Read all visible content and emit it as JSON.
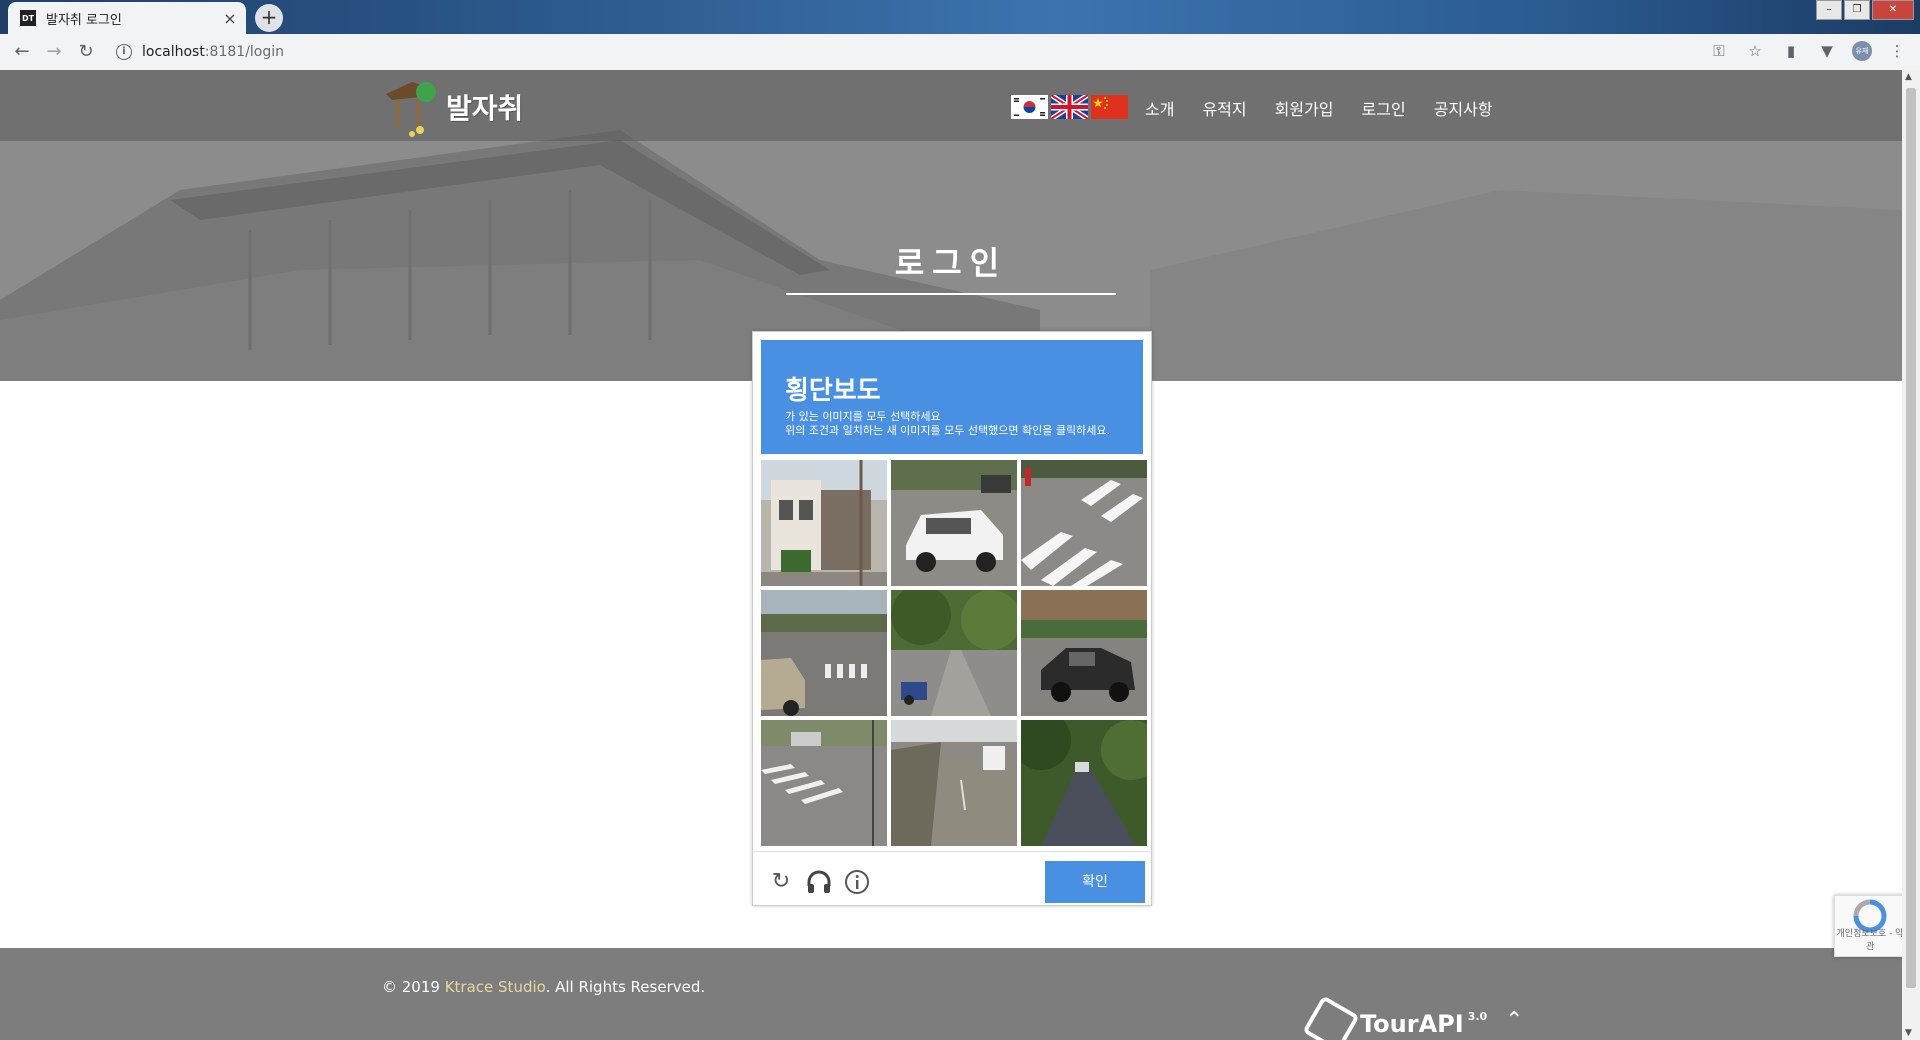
{
  "browser": {
    "tab_title": "발자취 로그인",
    "favicon": "DT",
    "tab_close": "×",
    "new_tab": "+",
    "url_host": "localhost",
    "url_rest": ":8181/login",
    "profile": "유재",
    "window_buttons": [
      "–",
      "❐",
      "✕"
    ]
  },
  "site": {
    "logo_text": "발자취",
    "flags": [
      "kr-flag",
      "uk-flag",
      "cn-flag"
    ],
    "menu": [
      "소개",
      "유적지",
      "회원가입",
      "로그인",
      "공지사항"
    ],
    "page_title": "로그인"
  },
  "captcha": {
    "keyword": "횡단보도",
    "instruction": "가 있는 이미지를 모두 선택하세요",
    "instruction2": "위의 조건과 일치하는 새 이미지를 모두 선택했으면 확인을 클릭하세요.",
    "verify_label": "확인",
    "tiles": [
      "house-street",
      "white-car",
      "crosswalk-stripes",
      "suv-road",
      "tree-street",
      "pickup-truck",
      "intersection-crosswalk",
      "highway-van",
      "wooded-road"
    ]
  },
  "footer": {
    "copyright_prefix": "© 2019 ",
    "studio": "Ktrace Studio",
    "copyright_suffix": ". All Rights Reserved.",
    "tourapi": "TourAPI",
    "tourapi_version": "3.0",
    "recaptcha_badge": "개인정보보호 - 약관"
  },
  "colors": {
    "captcha_blue": "#4a90e2",
    "nav_overlay": "#5a5a5a",
    "footer_bg": "#7d7d7d"
  }
}
